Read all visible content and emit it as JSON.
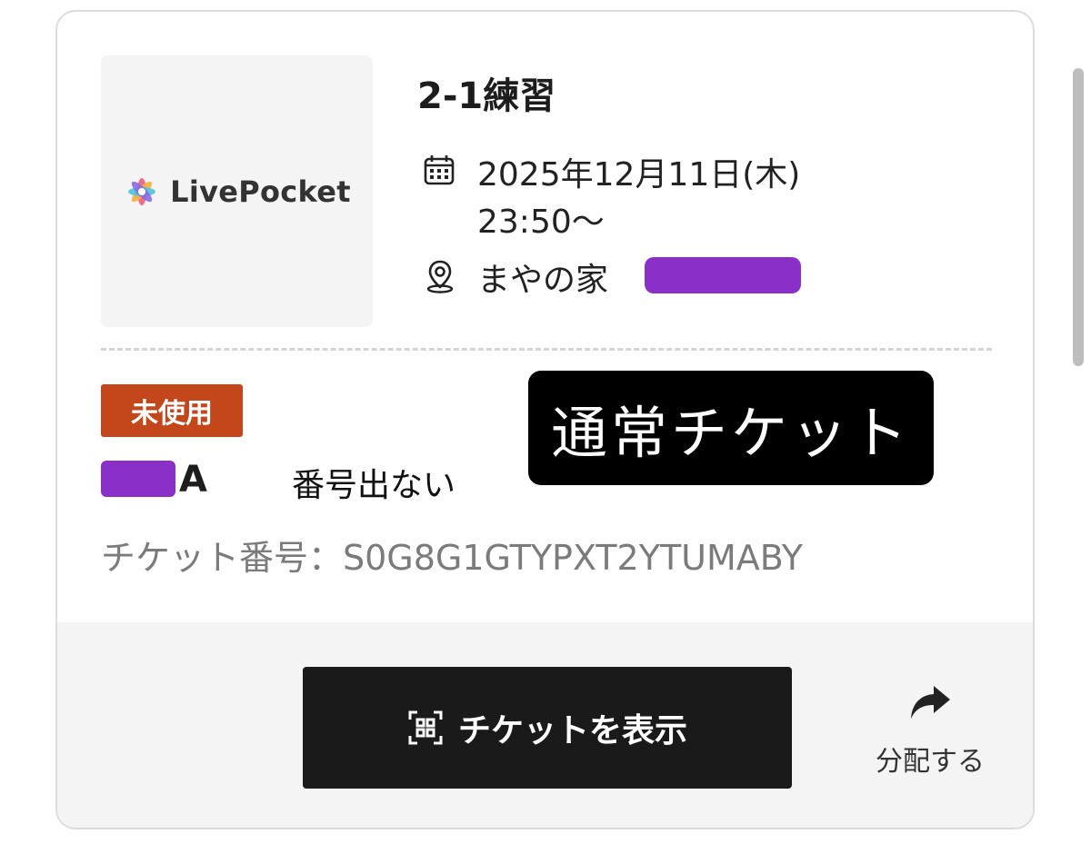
{
  "event": {
    "logo_text": "LivePocket",
    "title": "2-1練習",
    "date_line1": "2025年12月11日(木)",
    "date_line2": "23:50〜",
    "venue": "まやの家"
  },
  "ticket": {
    "status": "未使用",
    "seat_letter": "A",
    "ticket_number": "チケット番号：S0G8G1GTYPXT2YTUMABY"
  },
  "annotations": {
    "overlay_label": "通常チケット",
    "note": "番号出ない"
  },
  "actions": {
    "show_ticket_label": "チケットを表示",
    "share_label": "分配する"
  },
  "colors": {
    "status_badge": "#c4471b",
    "redaction": "#8a2fc8",
    "button": "#1a1a1a"
  },
  "icons": {
    "date": "calendar-icon",
    "venue": "location-pin-icon",
    "show_ticket": "qr-code-icon",
    "share": "share-arrow-icon"
  }
}
